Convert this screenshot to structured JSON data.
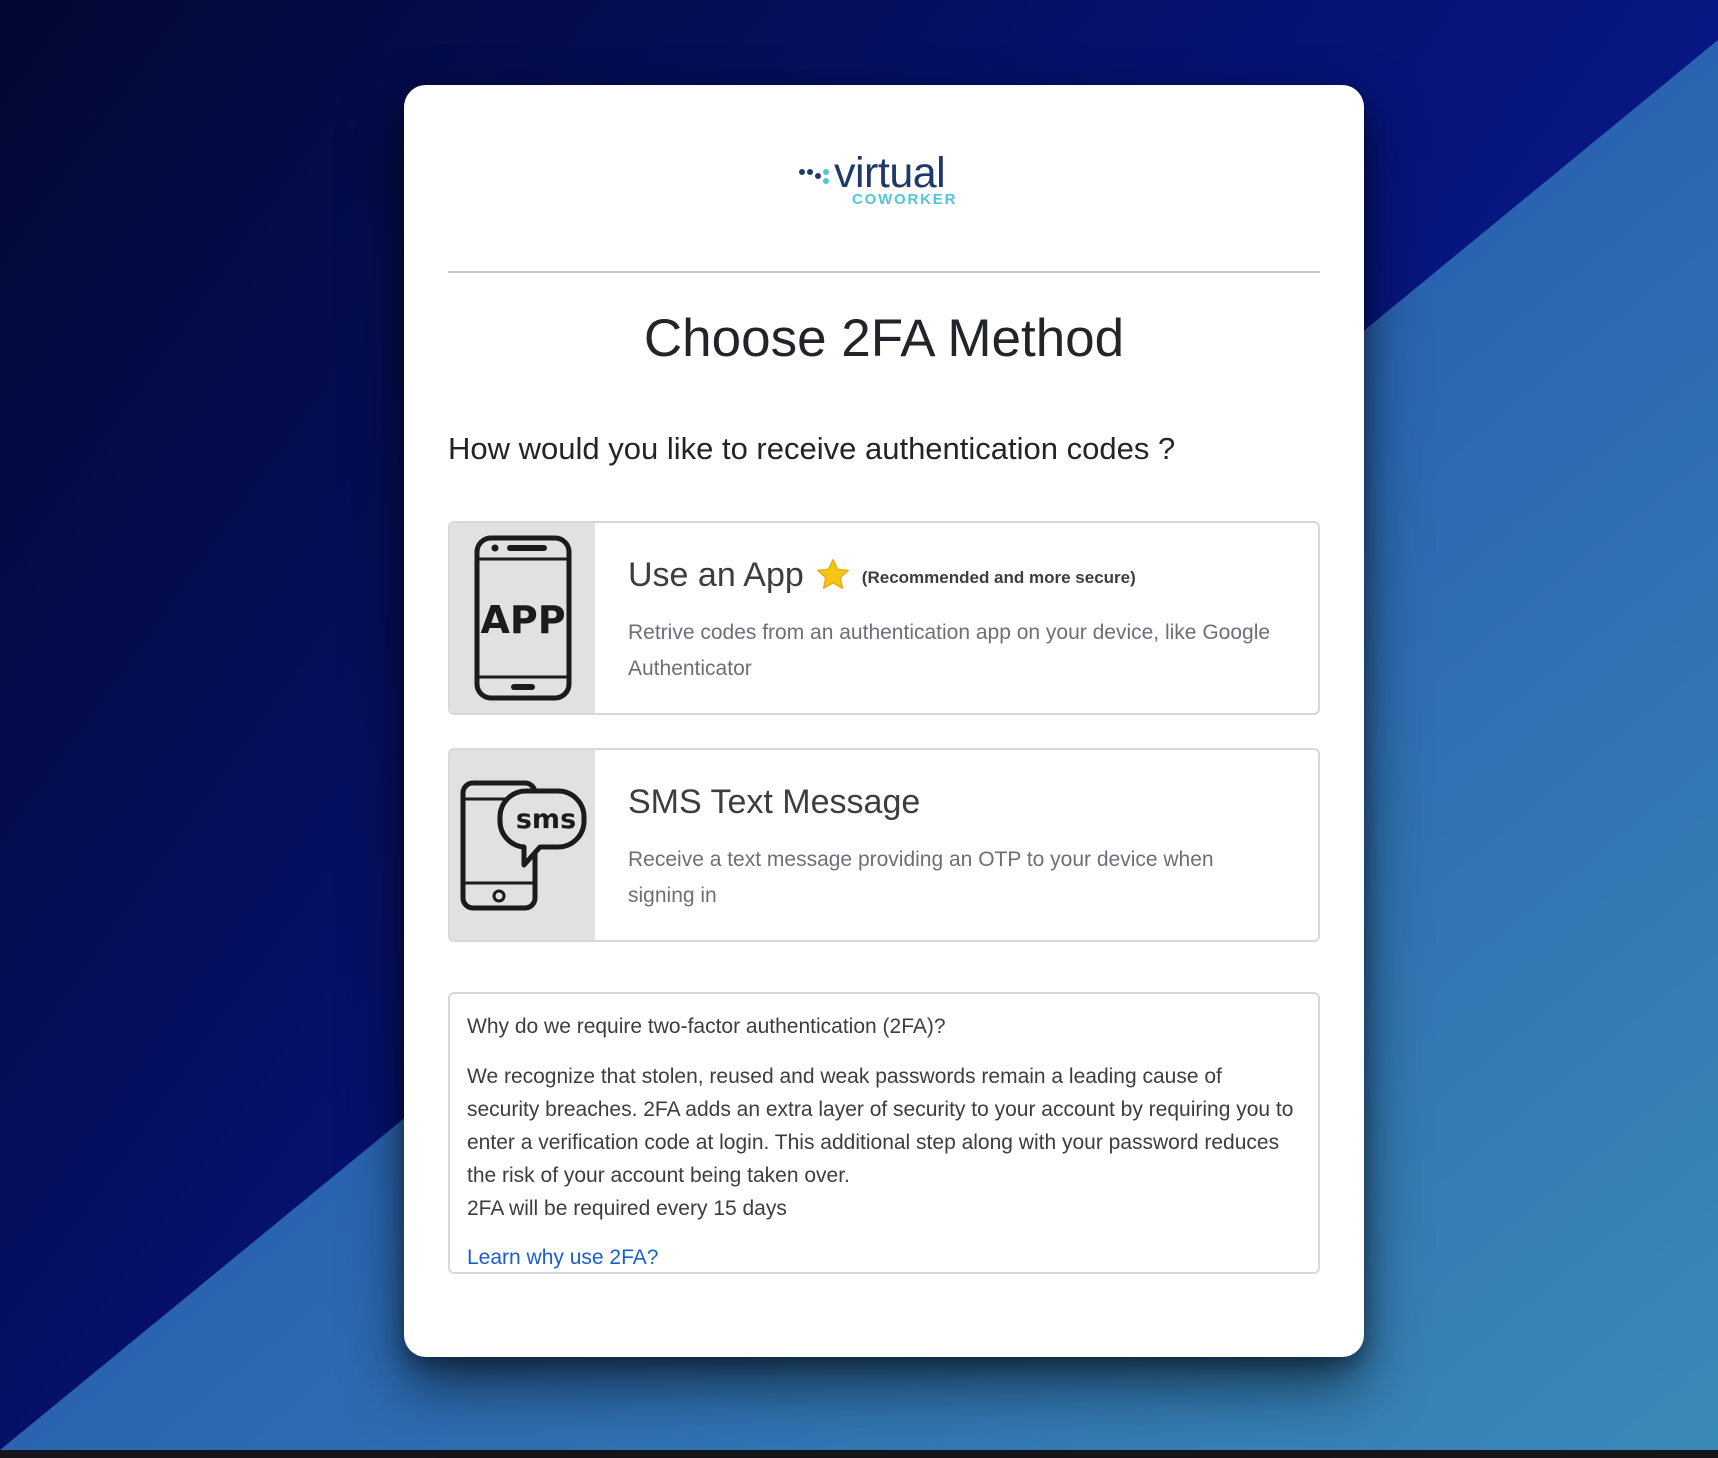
{
  "logo": {
    "word": "virtual",
    "sub": "COWORKER"
  },
  "page": {
    "title": "Choose 2FA Method",
    "question": "How would you like to receive authentication codes ?"
  },
  "options": [
    {
      "title": "Use an App",
      "tag": "(Recommended and more secure)",
      "description": "Retrive codes from an authentication app on your device, like Google Authenticator",
      "icon": "app-phone-icon",
      "icon_text": "APP",
      "badge_icon": "star-icon"
    },
    {
      "title": "SMS Text Message",
      "description": "Receive a text message providing an OTP to your device when signing in",
      "icon": "sms-phone-icon",
      "icon_text": "sms"
    }
  ],
  "info": {
    "question": "Why do we require two-factor authentication (2FA)?",
    "paragraph": "We recognize that stolen, reused and weak passwords remain a leading cause of security breaches. 2FA adds an extra layer of security to your account by requiring you to enter a verification code at login. This additional step along with your password reduces the risk of your account being taken over.",
    "frequency": "2FA will be required every 15 days",
    "link": "Learn why use 2FA?"
  },
  "colors": {
    "background_dark": "#020a3a",
    "background_mid": "#0a1a8a",
    "background_light": "#3a86b8",
    "brand_navy": "#1e3a6b",
    "brand_teal": "#4ec8d4",
    "link": "#1a5fd0",
    "star": "#f5c518"
  }
}
